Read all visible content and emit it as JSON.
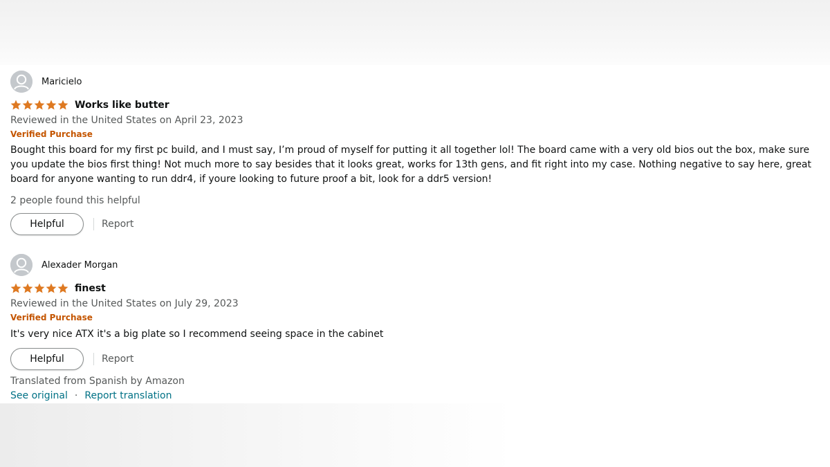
{
  "reviews": [
    {
      "profile_name": "Maricielo",
      "rating": 5,
      "rating_max": 5,
      "title": "Works like butter",
      "date_line": "Reviewed in the United States on April 23, 2023",
      "verified_label": "Verified Purchase",
      "body": "Bought this board for my first pc build, and I must say, I’m proud of myself for putting it all together lol! The board came with a very old bios out the box, make sure you update the bios first thing! Not much more to say besides that it looks great, works for 13th gens, and fit right into my case. Nothing negative to say here, great board for anyone wanting to run ddr4, if youre looking to future proof a bit, look for a ddr5 version!",
      "helpful_count": "2 people found this helpful",
      "helpful_label": "Helpful",
      "report_label": "Report"
    },
    {
      "profile_name": "Alexader Morgan",
      "rating": 5,
      "rating_max": 5,
      "title": "finest",
      "date_line": "Reviewed in the United States on July 29, 2023",
      "verified_label": "Verified Purchase",
      "body": "It's very nice ATX it's a big plate so I recommend seeing space in the cabinet",
      "helpful_label": "Helpful",
      "report_label": "Report",
      "translated_note": "Translated from Spanish by Amazon",
      "see_original_label": "See original",
      "separator": "·",
      "report_translation_label": "Report translation"
    }
  ],
  "icons": {
    "avatar": "default-profile-avatar-icon",
    "star": "star-filled-icon"
  },
  "colors": {
    "star": "#de7921",
    "verified": "#c45500",
    "link": "#007185",
    "secondary_text": "#565959",
    "avatar_bg": "#c4c8cc"
  }
}
